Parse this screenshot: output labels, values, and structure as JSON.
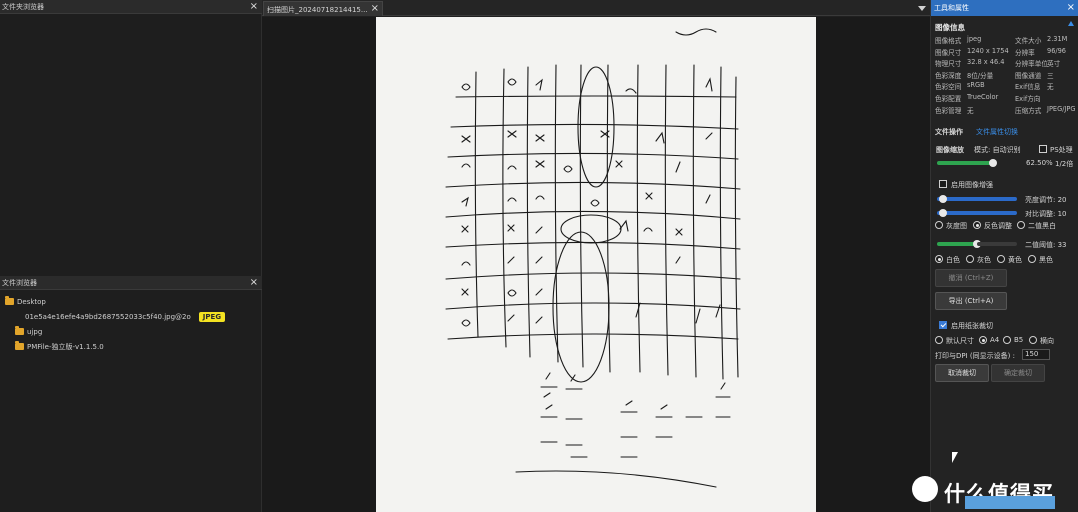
{
  "nav_top": {
    "title": "文件夹浏览器"
  },
  "nav_bottom": {
    "title": "文件浏览器",
    "items": [
      {
        "label": "Desktop",
        "type": "folder"
      },
      {
        "label": "01e5a4e16efe4a9bd2687552033c5f40.jpg@2o",
        "type": "file",
        "tag": "JPEG"
      },
      {
        "label": "ujpg",
        "type": "folder"
      },
      {
        "label": "PMFile-独立版-v1.1.5.0",
        "type": "folder"
      }
    ]
  },
  "tab": {
    "title": "扫描图片_20240718214415..."
  },
  "right": {
    "title": "工具和属性",
    "info_title": "图像信息",
    "info": [
      {
        "k1": "图像格式",
        "v1": "jpeg",
        "k2": "文件大小",
        "v2": "2.31M"
      },
      {
        "k1": "图像尺寸",
        "v1": "1240 x 1754",
        "k2": "分辨率",
        "v2": "96/96"
      },
      {
        "k1": "物理尺寸",
        "v1": "32.8 x 46.4",
        "k2": "分辨率单位",
        "v2": "英寸"
      },
      {
        "k1": "色彩深度",
        "v1": "8位/分量",
        "k2": "图像通道",
        "v2": "三"
      },
      {
        "k1": "色彩空间",
        "v1": "sRGB",
        "k2": "Exif信息",
        "v2": "无"
      },
      {
        "k1": "色彩配置",
        "v1": "TrueColor",
        "k2": "Exif方向",
        "v2": ""
      },
      {
        "k1": "色彩管理",
        "v1": "无",
        "k2": "压缩方式",
        "v2": "JPEG/JPG"
      }
    ],
    "ops_label": "文件操作",
    "ops_link": "文件属性切换",
    "compress_label": "图像缩放",
    "compress_hint": "模式: 自动识别",
    "ps_label": "PS处理",
    "zoom_value": "62.50%",
    "zoom_unit": "1/2倍",
    "denoise_label": "启用图像增强",
    "brightness_label": "亮度调节: 20",
    "contrast_label": "对比调整: 10",
    "modes": [
      "灰度图",
      "反色调整",
      "二值黑白"
    ],
    "threshold_label": "二值阈值: 33",
    "bg_options": [
      "白色",
      "灰色",
      "黄色",
      "黑色"
    ],
    "undo_button": "撤消 (Ctrl+Z)",
    "apply_button": "导出 (Ctrl+A)",
    "paper_label": "启用纸张裁切",
    "paper_sizes": [
      "默认尺寸",
      "A4",
      "B5",
      "横向"
    ],
    "dpi_label": "打印与DPI (同显示设备) :",
    "dpi_value": "150",
    "cancel_button": "取消裁切",
    "confirm_button": "确定裁切"
  },
  "watermark": {
    "text": "什么值得买"
  },
  "colors": {
    "accent": "#2e6fbf",
    "tag": "#f3e221",
    "folder": "#e2a52b",
    "slider_green": "#2ea44f"
  }
}
